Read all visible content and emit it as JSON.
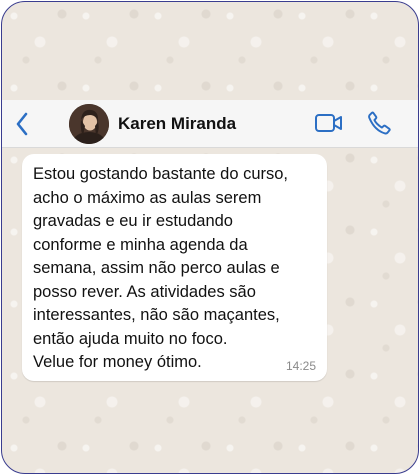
{
  "chat_header": {
    "contact_name": "Karen Miranda",
    "back_icon": "chevron-left-icon",
    "video_icon": "video-camera-icon",
    "call_icon": "phone-icon"
  },
  "message": {
    "text": "Estou gostando bastante do curso,\nacho o máximo as aulas serem\ngravadas e eu ir estudando\nconforme e minha agenda da\nsemana, assim não perco aulas e\nposso rever. As atividades são\ninteressantes, não são maçantes,\nentão ajuda muito no foco.\nVelue for money ótimo.",
    "time": "14:25"
  },
  "colors": {
    "accent": "#2c6fc4",
    "header_bg": "#f6f6f6",
    "chat_bg": "#ece6de",
    "bubble_bg": "#ffffff",
    "frame_border": "#3a3d8f"
  }
}
